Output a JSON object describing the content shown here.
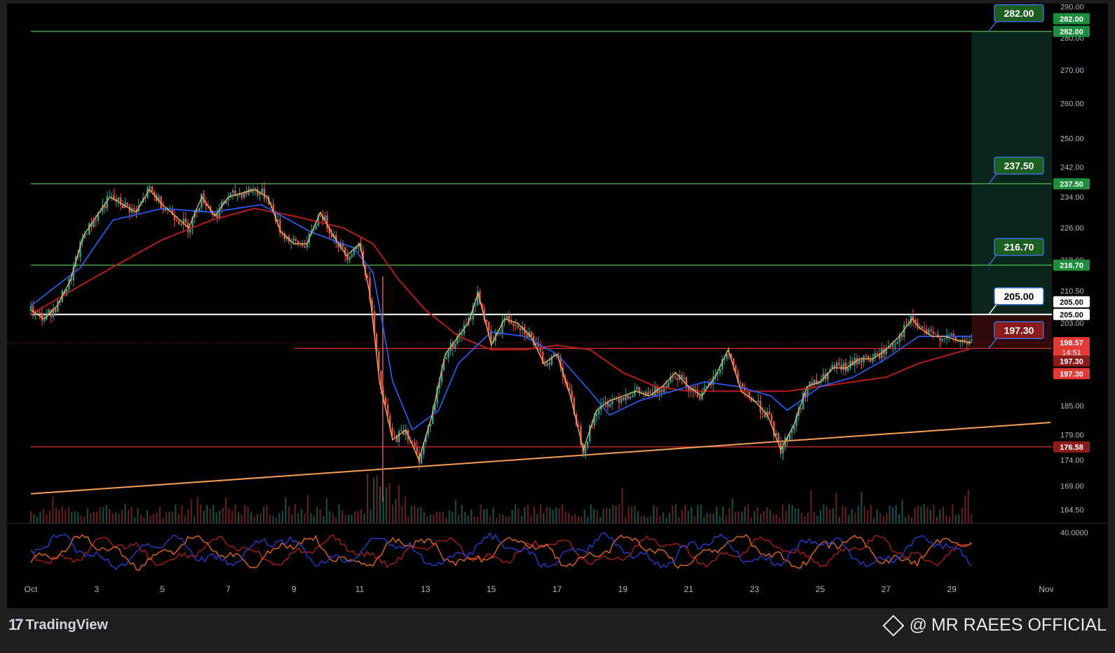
{
  "chart_data": {
    "type": "candlestick",
    "y_scale": "log",
    "ylim": [
      162,
      291
    ],
    "price_axis_ticks": [
      "290.00",
      "280.00",
      "270.00",
      "260.00",
      "250.00",
      "242.00",
      "234.00",
      "226.00",
      "218.00",
      "210.50",
      "203.00",
      "185.00",
      "179.00",
      "174.00",
      "169.00",
      "164.50"
    ],
    "x_axis_ticks": [
      "Oct",
      "3",
      "5",
      "7",
      "9",
      "11",
      "13",
      "15",
      "17",
      "19",
      "21",
      "23",
      "25",
      "27",
      "29",
      "Nov"
    ],
    "x_axis_day": [
      1,
      3,
      5,
      7,
      9,
      11,
      13,
      15,
      17,
      19,
      21,
      23,
      25,
      27,
      29,
      32
    ],
    "price_path": [
      [
        0.0,
        206
      ],
      [
        0.4,
        204
      ],
      [
        0.8,
        207
      ],
      [
        1.2,
        213
      ],
      [
        1.6,
        224
      ],
      [
        2.0,
        229
      ],
      [
        2.4,
        234
      ],
      [
        2.8,
        232
      ],
      [
        3.2,
        230
      ],
      [
        3.6,
        236
      ],
      [
        4.0,
        232
      ],
      [
        4.4,
        229
      ],
      [
        4.8,
        226
      ],
      [
        5.2,
        234
      ],
      [
        5.6,
        229
      ],
      [
        6.0,
        234
      ],
      [
        6.4,
        235
      ],
      [
        6.8,
        236
      ],
      [
        7.2,
        234
      ],
      [
        7.6,
        225
      ],
      [
        8.0,
        222
      ],
      [
        8.4,
        222
      ],
      [
        8.8,
        230
      ],
      [
        9.2,
        224
      ],
      [
        9.6,
        219
      ],
      [
        10.0,
        222
      ],
      [
        10.3,
        210
      ],
      [
        10.6,
        190
      ],
      [
        11.0,
        178
      ],
      [
        11.4,
        180
      ],
      [
        11.8,
        174
      ],
      [
        12.2,
        183
      ],
      [
        12.6,
        196
      ],
      [
        13.0,
        200
      ],
      [
        13.3,
        203
      ],
      [
        13.6,
        210
      ],
      [
        14.0,
        198
      ],
      [
        14.4,
        204
      ],
      [
        14.8,
        203
      ],
      [
        15.2,
        200
      ],
      [
        15.6,
        194
      ],
      [
        16.0,
        196
      ],
      [
        16.4,
        187
      ],
      [
        16.8,
        176
      ],
      [
        17.2,
        184
      ],
      [
        17.6,
        186
      ],
      [
        18.0,
        187
      ],
      [
        18.4,
        188
      ],
      [
        18.8,
        187
      ],
      [
        19.2,
        189
      ],
      [
        19.6,
        192
      ],
      [
        20.0,
        189
      ],
      [
        20.4,
        187
      ],
      [
        20.8,
        191
      ],
      [
        21.2,
        197
      ],
      [
        21.6,
        188
      ],
      [
        22.0,
        186
      ],
      [
        22.4,
        183
      ],
      [
        22.8,
        176
      ],
      [
        23.2,
        181
      ],
      [
        23.6,
        189
      ],
      [
        24.0,
        190
      ],
      [
        24.4,
        193
      ],
      [
        24.8,
        193
      ],
      [
        25.2,
        195
      ],
      [
        25.6,
        195
      ],
      [
        26.0,
        197
      ],
      [
        26.4,
        200
      ],
      [
        26.8,
        204
      ],
      [
        27.0,
        202
      ],
      [
        27.4,
        200
      ],
      [
        27.8,
        200
      ],
      [
        28.2,
        199
      ],
      [
        28.6,
        198.6
      ]
    ],
    "moving_average_fast": [
      [
        0.0,
        207
      ],
      [
        1.5,
        216
      ],
      [
        2.5,
        228
      ],
      [
        4.0,
        231
      ],
      [
        5.5,
        230
      ],
      [
        7.0,
        232
      ],
      [
        8.5,
        225
      ],
      [
        9.8,
        221
      ],
      [
        10.4,
        215
      ],
      [
        11.0,
        190
      ],
      [
        11.6,
        180
      ],
      [
        12.4,
        184
      ],
      [
        13.0,
        194
      ],
      [
        14.0,
        201
      ],
      [
        15.0,
        200
      ],
      [
        16.0,
        196
      ],
      [
        17.0,
        188
      ],
      [
        17.6,
        183
      ],
      [
        18.5,
        186
      ],
      [
        19.5,
        188
      ],
      [
        20.5,
        190
      ],
      [
        21.5,
        189
      ],
      [
        22.5,
        187
      ],
      [
        23.0,
        184
      ],
      [
        24.0,
        189
      ],
      [
        25.0,
        191
      ],
      [
        26.0,
        195
      ],
      [
        27.0,
        200
      ],
      [
        28.6,
        200
      ]
    ],
    "moving_average_slow": [
      [
        0.0,
        205
      ],
      [
        2.0,
        214
      ],
      [
        4.0,
        223
      ],
      [
        5.5,
        228
      ],
      [
        6.8,
        231
      ],
      [
        8.0,
        229
      ],
      [
        9.5,
        226
      ],
      [
        10.4,
        222
      ],
      [
        11.2,
        213
      ],
      [
        12.0,
        206
      ],
      [
        13.0,
        200
      ],
      [
        14.0,
        197
      ],
      [
        15.0,
        197
      ],
      [
        16.0,
        198
      ],
      [
        17.0,
        197
      ],
      [
        18.0,
        192
      ],
      [
        19.0,
        189
      ],
      [
        20.0,
        188
      ],
      [
        21.0,
        188
      ],
      [
        22.0,
        188
      ],
      [
        23.0,
        188
      ],
      [
        24.0,
        189
      ],
      [
        25.0,
        190
      ],
      [
        26.0,
        191
      ],
      [
        27.0,
        194
      ],
      [
        28.6,
        197.3
      ]
    ],
    "trendline": {
      "start": [
        0.0,
        167.5
      ],
      "end": [
        31.0,
        181.5
      ]
    },
    "volume_bars": 300,
    "levels": [
      {
        "price": 282.0,
        "label": "282.00",
        "color": "#4caf50",
        "marker_color": "#1b5e20",
        "axis_color": "#1e8e3e",
        "start_day": 0
      },
      {
        "price": 237.5,
        "label": "237.50",
        "color": "#4caf50",
        "marker_color": "#1b5e20",
        "axis_color": "#1e8e3e",
        "start_day": 0
      },
      {
        "price": 216.7,
        "label": "216.70",
        "color": "#4caf50",
        "marker_color": "#1b5e20",
        "axis_color": "#1e8e3e",
        "start_day": 0
      },
      {
        "price": 205.0,
        "label": "205.00",
        "color": "#ffffff",
        "marker_color": "#ffffff",
        "axis_color": "#ffffff",
        "start_day": 0
      },
      {
        "price": 197.3,
        "label": "197.30",
        "color": "#c62828",
        "marker_color": "#8b1a1a",
        "axis_color": "#8b1a1a",
        "start_day": 8.0
      },
      {
        "price": 176.58,
        "label": "176.58",
        "color": "#c62828",
        "marker_color": "#8b1a1a",
        "axis_color": "#8b1a1a",
        "start_day": 0
      }
    ],
    "axis_tags": {
      "top_duplicate": "282.00",
      "mid_duplicate": "205.00",
      "current_price": "198.57",
      "countdown": "14:51",
      "stop_1": "197.30",
      "stop_2": "197.30"
    },
    "position_zone": {
      "entry": 197.3,
      "target": 282.0,
      "stop": 205.0,
      "start_day": 28.6,
      "end_day": 31.2
    },
    "oscillator": {
      "scale_label": "40.0000"
    },
    "colors": {
      "background": "#000000",
      "axis_text": "#b2b5be",
      "candle_up": "#26a69a",
      "candle_down": "#ef5350",
      "ma_fast": "#2962ff",
      "ma_slow": "#b71c1c",
      "price_line": "#e8b25a",
      "trendline": "#f5a05a",
      "osc_blue": "#2b3ee0",
      "osc_orange": "#f26c1a",
      "osc_red": "#b81d1d"
    }
  },
  "branding": {
    "logo_mark": "17",
    "logo_text": "TradingView",
    "watermark_at": "@",
    "watermark_text": "MR RAEES OFFICIAL"
  }
}
